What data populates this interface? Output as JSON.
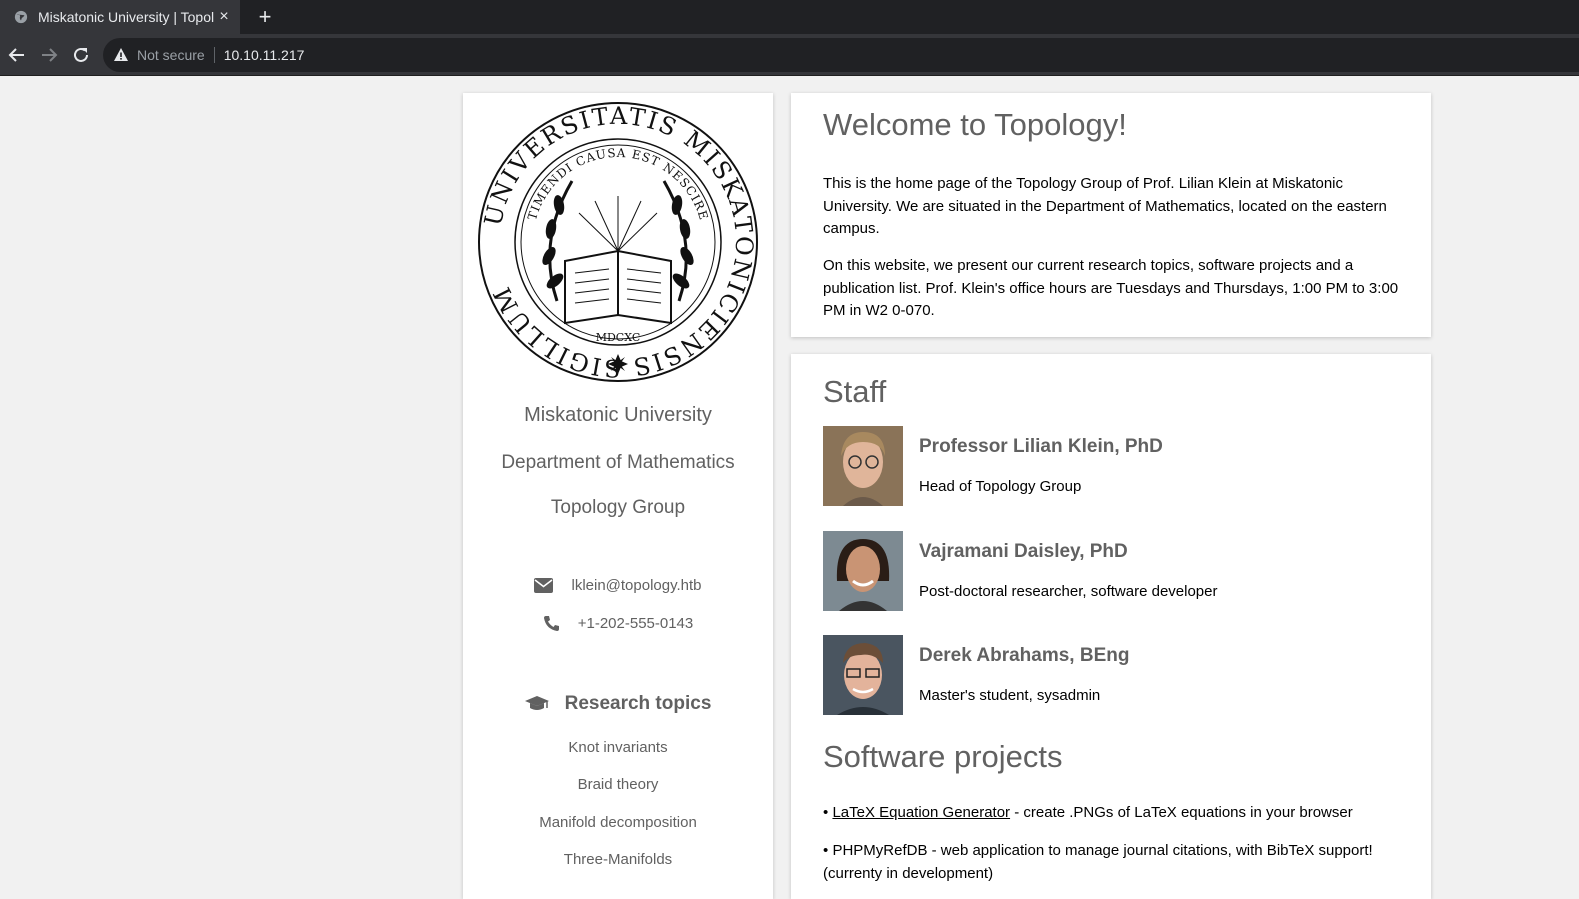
{
  "browser": {
    "tab_title": "Miskatonic University | Topology Group",
    "new_tab_label": "+",
    "close_label": "×",
    "security_text": "Not secure",
    "url": "10.10.11.217"
  },
  "sidebar": {
    "seal": {
      "outer_text": "UNIVERSITATIS MISKATONICIENSIS SIGILLUM",
      "inner_text": "TIMENDI CAUSA EST NESCIRE",
      "year": "MDCXC"
    },
    "university": "Miskatonic University",
    "department": "Department of Mathematics",
    "group": "Topology Group",
    "email": "lklein@topology.htb",
    "phone": "+1-202-555-0143",
    "research_heading": "Research topics",
    "research_topics": [
      "Knot invariants",
      "Braid theory",
      "Manifold decomposition",
      "Three-Manifolds"
    ]
  },
  "welcome": {
    "title": "Welcome to Topology!",
    "para1": "This is the home page of the Topology Group of Prof. Lilian Klein at Miskatonic University. We are situated in the Department of Mathematics, located on the eastern campus.",
    "para2": "On this website, we present our current research topics, software projects and a publication list. Prof. Klein's office hours are Tuesdays and Thursdays, 1:00 PM to 3:00 PM in W2 0-070."
  },
  "staff": {
    "title": "Staff",
    "members": [
      {
        "name": "Professor Lilian Klein, PhD",
        "role": "Head of Topology Group"
      },
      {
        "name": "Vajramani Daisley, PhD",
        "role": "Post-doctoral researcher, software developer"
      },
      {
        "name": "Derek Abrahams, BEng",
        "role": "Master's student, sysadmin"
      }
    ]
  },
  "software": {
    "title": "Software projects",
    "bullet": "•",
    "project1_link": "LaTeX Equation Generator",
    "project1_desc": " - create .PNGs of LaTeX equations in your browser",
    "project2": "PHPMyRefDB - web application to manage journal citations, with BibTeX support! (currenty in development)"
  },
  "colors": {
    "text_muted": "#616161",
    "page_bg": "#f1f1f1",
    "chrome_dark": "#202124",
    "chrome_mid": "#35363a"
  }
}
